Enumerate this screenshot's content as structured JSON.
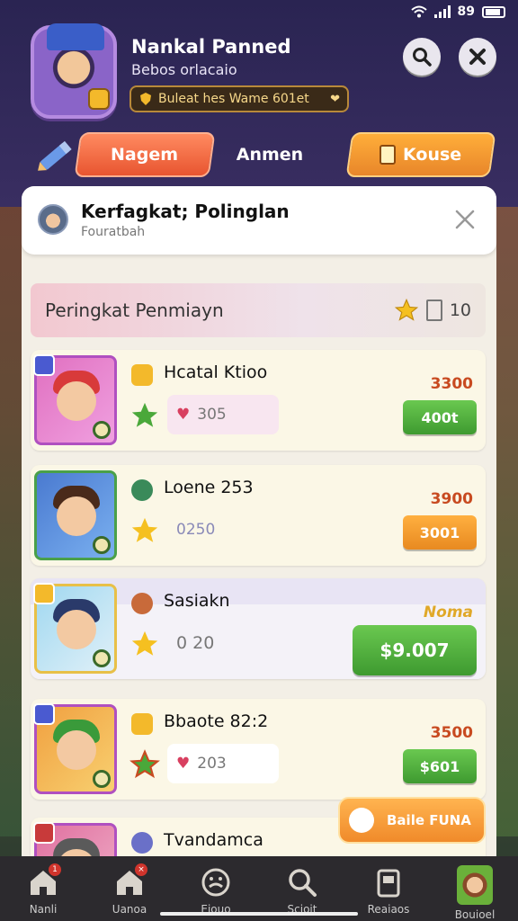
{
  "status_bar": {
    "battery": "89"
  },
  "header": {
    "player_name": "Nankal Panned",
    "player_sub": "Bebos orlacaio",
    "level_text": "Buleat hes Wame 601et"
  },
  "tabs": [
    {
      "label": "Nagem"
    },
    {
      "label": "Anmen"
    },
    {
      "label": "Kouse"
    }
  ],
  "panel": {
    "title": "Kerfagkat; Polinglan",
    "subtitle": "Fouratbah"
  },
  "section": {
    "label": "Peringkat Penmiayn",
    "count": "10"
  },
  "rows": [
    {
      "name": "Hcatal Ktioo",
      "stat": "305",
      "score": "3300",
      "action": "400t"
    },
    {
      "name": "Loene 253",
      "stat": "0250",
      "score": "3900",
      "action": "3001"
    },
    {
      "name": "Sasiakn",
      "stat": "0 20",
      "score": "Noma",
      "action": "$9.007"
    },
    {
      "name": "Bbaote 82:2",
      "stat": "203",
      "score": "3500",
      "action": "$601"
    },
    {
      "name": "Tvandamca"
    }
  ],
  "promo": {
    "label": "Baile FUNA"
  },
  "bottom_nav": [
    {
      "label": "Nanli",
      "icon": "home-icon"
    },
    {
      "label": "Uanoa",
      "icon": "home-icon"
    },
    {
      "label": "Eiouo",
      "icon": "face-icon"
    },
    {
      "label": "Scioit",
      "icon": "search-icon"
    },
    {
      "label": "Reaiaos",
      "icon": "archive-icon"
    },
    {
      "label": "Bouioel",
      "icon": "avatar"
    }
  ],
  "colors": {
    "accent_orange": "#e8862a",
    "accent_green": "#3e9a30",
    "panel_bg": "#f3efe6"
  }
}
